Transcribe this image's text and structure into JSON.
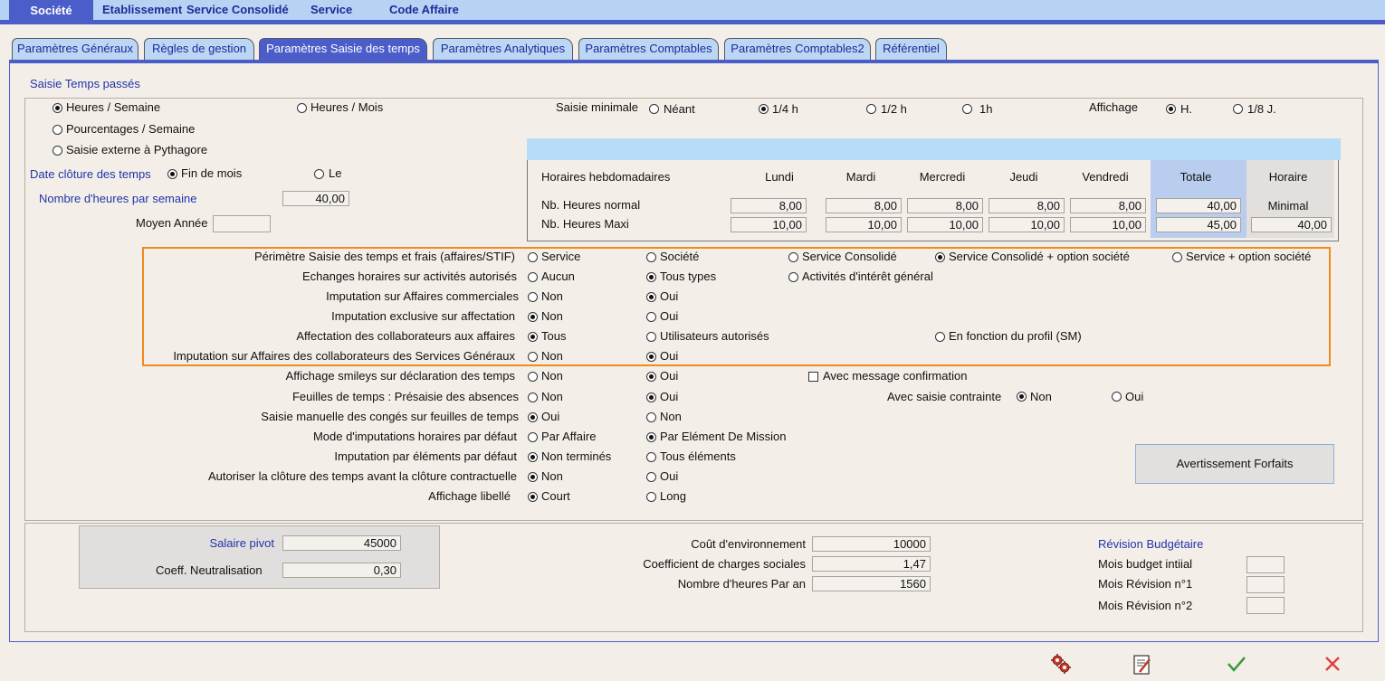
{
  "menu": {
    "societe": "Société",
    "etablissement": "Etablissement",
    "service_consolide": "Service Consolidé",
    "service": "Service",
    "code_affaire": "Code Affaire"
  },
  "tabs": [
    {
      "label": "Paramètres Généraux"
    },
    {
      "label": "Règles de gestion"
    },
    {
      "label": "Paramètres Saisie des temps",
      "active": true
    },
    {
      "label": "Paramètres Analytiques"
    },
    {
      "label": "Paramètres Comptables"
    },
    {
      "label": "Paramètres Comptables2"
    },
    {
      "label": "Référentiel"
    }
  ],
  "saisie": {
    "title": "Saisie Temps passés",
    "heures_semaine": "Heures / Semaine",
    "heures_mois": "Heures / Mois",
    "pourcentages_semaine": "Pourcentages / Semaine",
    "saisie_externe": "Saisie externe à Pythagore",
    "date_cloture_label": "Date clôture des temps",
    "fin_de_mois": "Fin de mois",
    "le": "Le",
    "nb_heures_label": "Nombre d'heures par semaine",
    "nb_heures_value": "40,00",
    "moyen_annee_label": "Moyen Année",
    "moyen_annee_value": "",
    "saisie_minimale_label": "Saisie minimale",
    "neant": "Néant",
    "quart_h": "1/4 h",
    "demi_h": "1/2 h",
    "un_h": "1h",
    "affichage_label": "Affichage",
    "aff_h": "H.",
    "aff_8j": "1/8 J."
  },
  "horaires": {
    "title": "Horaires hebdomadaires",
    "days": [
      "Lundi",
      "Mardi",
      "Mercredi",
      "Jeudi",
      "Vendredi"
    ],
    "totale": "Totale",
    "horaire": "Horaire",
    "minimal": "Minimal",
    "normal_label": "Nb. Heures normal",
    "maxi_label": "Nb. Heures Maxi",
    "normal": [
      "8,00",
      "8,00",
      "8,00",
      "8,00",
      "8,00"
    ],
    "normal_total": "40,00",
    "maxi": [
      "10,00",
      "10,00",
      "10,00",
      "10,00",
      "10,00"
    ],
    "maxi_total": "45,00",
    "maxi_minimal": "40,00"
  },
  "rules": [
    {
      "label": "Périmètre Saisie des temps et frais (affaires/STIF)",
      "options": [
        "Service",
        "Société",
        "Service Consolidé",
        "Service Consolidé + option société",
        "Service + option société"
      ],
      "selected": 3
    },
    {
      "label": "Echanges horaires sur activités autorisés",
      "options": [
        "Aucun",
        "Tous types",
        "Activités d'intérêt général"
      ],
      "selected": 1
    },
    {
      "label": "Imputation sur Affaires commerciales",
      "options": [
        "Non",
        "Oui"
      ],
      "selected": 1
    },
    {
      "label": "Imputation exclusive sur affectation",
      "options": [
        "Non",
        "Oui"
      ],
      "selected": 0
    },
    {
      "label": "Affectation des collaborateurs aux affaires",
      "options": [
        "Tous",
        "Utilisateurs autorisés",
        "En fonction du profil (SM)"
      ],
      "selected": 0
    },
    {
      "label": "Imputation sur Affaires des collaborateurs des Services Généraux",
      "options": [
        "Non",
        "Oui"
      ],
      "selected": 1
    },
    {
      "label": "Affichage smileys sur déclaration des temps",
      "options": [
        "Non",
        "Oui"
      ],
      "selected": 1
    },
    {
      "label": "Feuilles de temps : Présaisie des absences",
      "options": [
        "Non",
        "Oui"
      ],
      "selected": 1
    },
    {
      "label": "Saisie manuelle des congés sur feuilles de temps",
      "options": [
        "Oui",
        "Non"
      ],
      "selected": 0
    },
    {
      "label": "Mode d'imputations horaires par défaut",
      "options": [
        "Par Affaire",
        "Par Elément De Mission"
      ],
      "selected": 1
    },
    {
      "label": "Imputation par éléments par défaut",
      "options": [
        "Non terminés",
        "Tous éléments"
      ],
      "selected": 0
    },
    {
      "label": "Autoriser la clôture des temps avant la clôture contractuelle",
      "options": [
        "Non",
        "Oui"
      ],
      "selected": 0
    },
    {
      "label": "Affichage libellé",
      "options": [
        "Court",
        "Long"
      ],
      "selected": 0
    }
  ],
  "extras": {
    "avec_message": "Avec message confirmation",
    "avec_saisie_contrainte": "Avec saisie contrainte",
    "contrainte_non": "Non",
    "contrainte_oui": "Oui",
    "avertissement_button": "Avertissement Forfaits"
  },
  "bottom": {
    "salaire_pivot_label": "Salaire pivot",
    "salaire_pivot_value": "45000",
    "coeff_label": "Coeff. Neutralisation",
    "coeff_value": "0,30",
    "cout_env_label": "Coût d'environnement",
    "cout_env_value": "10000",
    "coeff_charges_label": "Coefficient de charges sociales",
    "coeff_charges_value": "1,47",
    "nb_heures_an_label": "Nombre d'heures Par an",
    "nb_heures_an_value": "1560",
    "revision_title": "Révision Budgétaire",
    "mois_initial_label": "Mois budget intiial",
    "mois_rev1_label": "Mois Révision n°1",
    "mois_rev2_label": "Mois Révision n°2"
  },
  "colors": {
    "accent": "#4a5dc9",
    "menu_bg": "#b7d3f3",
    "highlight_border": "#f08a1c",
    "close_red": "#e04040",
    "ok_green": "#3a9a3a"
  }
}
